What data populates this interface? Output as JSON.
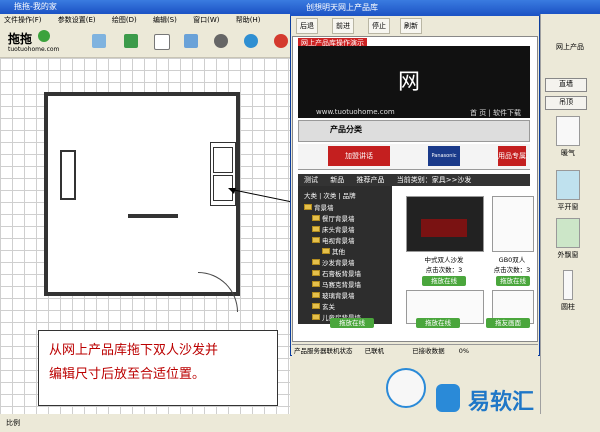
{
  "main_window": {
    "title": "拖拖-我的家",
    "menu": [
      "文件操作(F)",
      "参数设置(E)",
      "绘图(D)",
      "编辑(S)",
      "窗口(W)",
      "帮助(H)"
    ],
    "logo_text": "拖拖",
    "logo_url": "tuotuohome.com"
  },
  "popup": {
    "title": "创想明天网上产品库",
    "nav": {
      "back": "后退",
      "forward": "前进",
      "stop": "停止",
      "refresh": "刷新"
    },
    "site_tab": "网上产品库操作演示",
    "banner_text": "网",
    "banner_url": "www.tuotuohome.com",
    "banner_links": "首 页  |  软件下载",
    "category_title": "产品分类",
    "promo_text": "加盟讲话",
    "brand_logo": "Panasonic",
    "promo2": "用品专属",
    "tabs": [
      "测试",
      "新品",
      "推荐产品"
    ],
    "breadcrumb": "当前类别：家具>>沙发",
    "tree_header": [
      "大类",
      "次类",
      "品牌"
    ],
    "tree": [
      "背景墙",
      "餐厅背景墙",
      "床头背景墙",
      "电视背景墙",
      "其他",
      "沙发背景墙",
      "石膏板背景墙",
      "马赛克背景墙",
      "玻璃背景墙",
      "玄关",
      "儿童房背景墙"
    ],
    "product1": {
      "name": "中式双人沙发",
      "clicks": "点击次数：3"
    },
    "product2": {
      "name": "GB0双人",
      "clicks": "点击次数：3"
    },
    "drag_label": "拖放在线",
    "bottom_btn": "拖友画面",
    "status": [
      "产品服务器联机状态",
      "已联机",
      "已接收数据",
      "0%"
    ]
  },
  "right_panel": {
    "title": "网上产品",
    "buttons": [
      "直墙",
      "吊顶"
    ],
    "items": [
      "暖气",
      "平开窗",
      "外飘窗",
      "圆柱"
    ]
  },
  "caption": {
    "line1": "从网上产品库拖下双人沙发并",
    "line2": "编辑尺寸后放至合适位置。"
  },
  "watermark": "易软汇",
  "bottom_status": "比例"
}
